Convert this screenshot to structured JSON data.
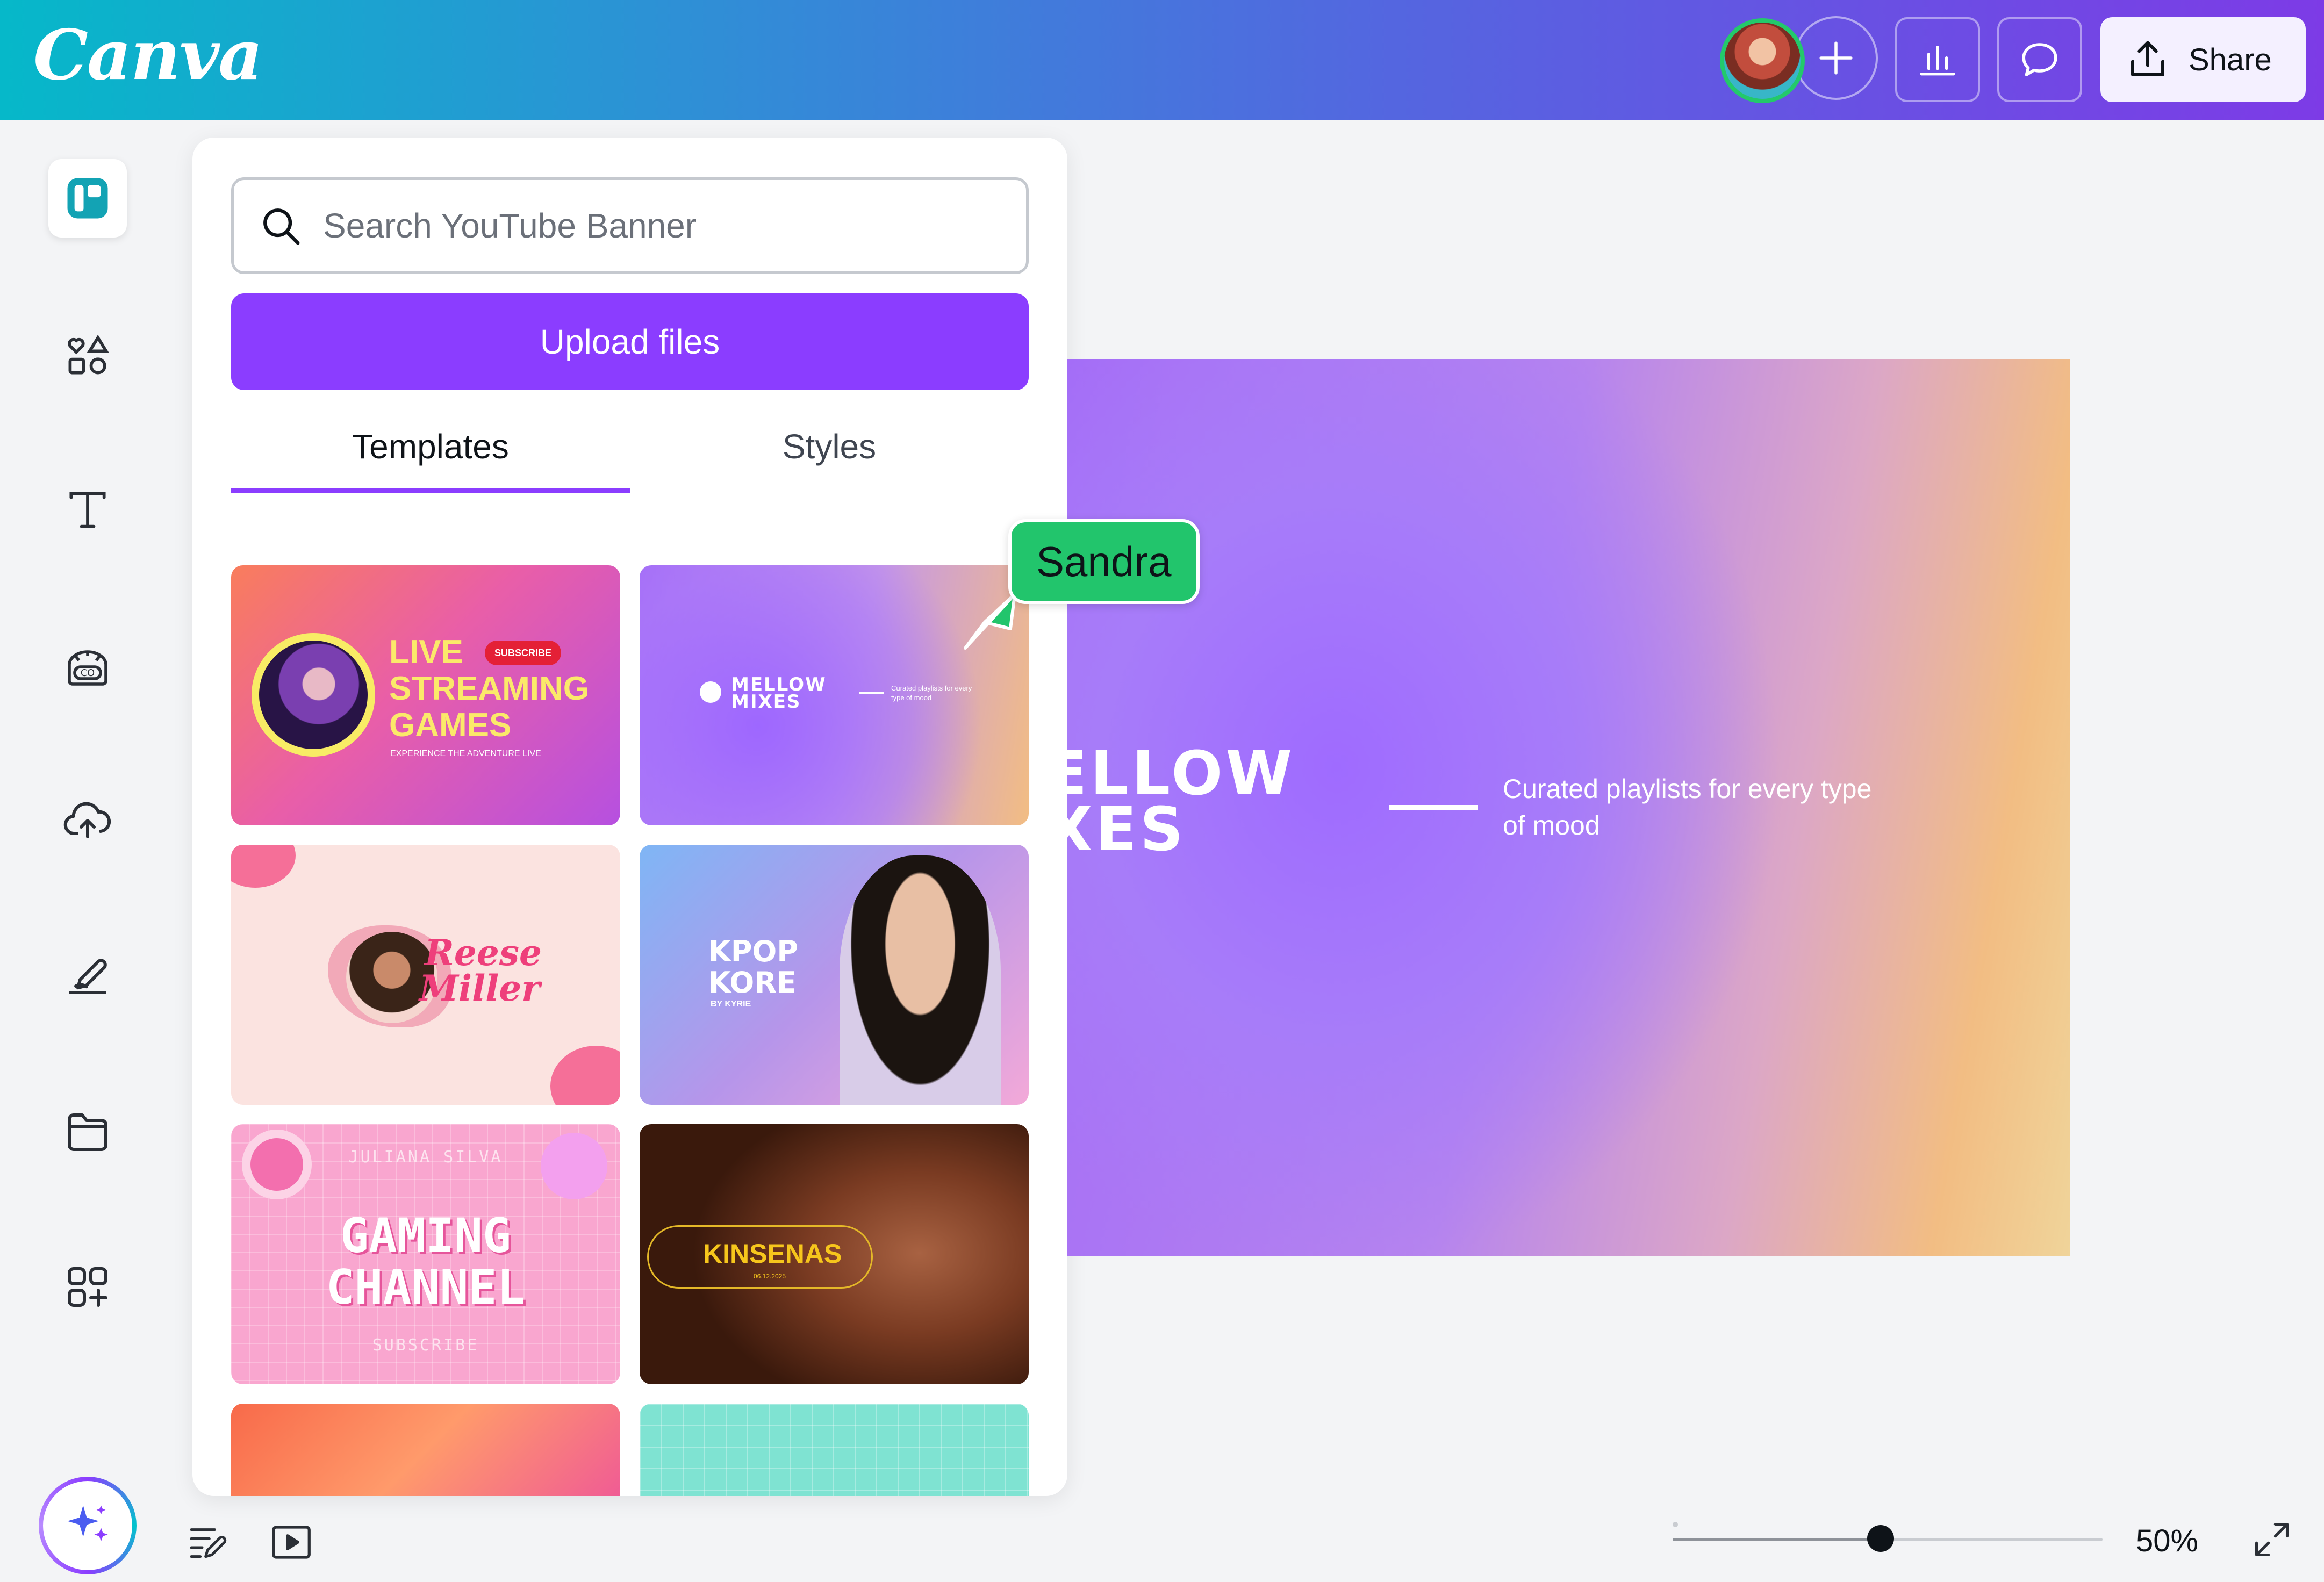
{
  "app": {
    "logo": "Canva"
  },
  "header": {
    "share_label": "Share"
  },
  "panel": {
    "search_placeholder": "Search YouTube Banner",
    "upload_label": "Upload files",
    "tabs": [
      {
        "label": "Templates"
      },
      {
        "label": "Styles"
      }
    ],
    "templates": [
      {
        "title_lines": [
          "LIVE",
          "STREAMING",
          "GAMES"
        ],
        "badge": "SUBSCRIBE",
        "tagline": "EXPERIENCE THE ADVENTURE LIVE"
      },
      {
        "title_lines": [
          "MELLOW",
          "MIXES"
        ],
        "caption": "Curated playlists for every type of mood"
      },
      {
        "title_lines": [
          "Reese",
          "Miller"
        ]
      },
      {
        "title_lines": [
          "KPOP",
          "KORE"
        ],
        "byline": "BY KYRIE"
      },
      {
        "top": "JULIANA SILVA",
        "title_lines": [
          "GAMING",
          "CHANNEL"
        ],
        "bottom": "SUBSCRIBE"
      },
      {
        "title_lines": [
          "KINSENAS"
        ],
        "date": "06.12.2025"
      }
    ]
  },
  "canvas": {
    "heading_lines": [
      "ELLOW",
      "XES"
    ],
    "subtitle": "Curated playlists for every type of mood"
  },
  "collaborator": {
    "name": "Sandra"
  },
  "footer": {
    "zoom_label": "50%",
    "zoom_value": 0.5
  }
}
